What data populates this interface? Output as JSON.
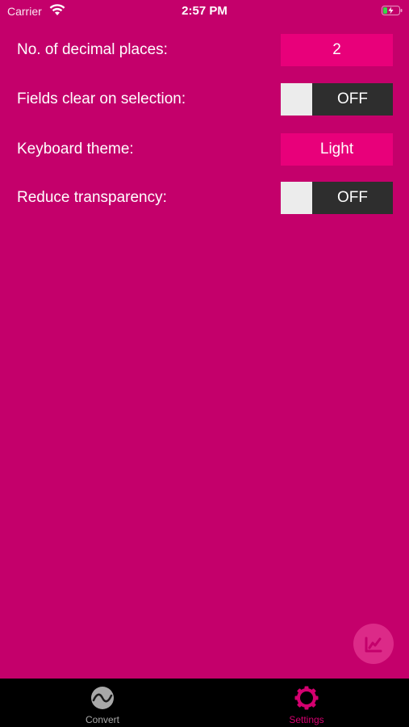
{
  "status_bar": {
    "carrier": "Carrier",
    "time": "2:57 PM",
    "wifi_icon": "wifi-icon",
    "battery_icon": "battery-charging-icon"
  },
  "settings": {
    "decimal_places": {
      "label": "No. of decimal places:",
      "value": "2"
    },
    "fields_clear": {
      "label": "Fields clear on selection:",
      "state": "OFF"
    },
    "keyboard_theme": {
      "label": "Keyboard theme:",
      "value": "Light"
    },
    "reduce_transparency": {
      "label": "Reduce transparency:",
      "state": "OFF"
    }
  },
  "fab": {
    "icon": "edit-chart-icon"
  },
  "tabs": [
    {
      "label": "Convert",
      "icon": "convert-wave-icon",
      "active": false
    },
    {
      "label": "Settings",
      "icon": "gear-icon",
      "active": true
    }
  ],
  "colors": {
    "background": "#c4006b",
    "value_button": "#e8007a",
    "toggle_track": "#2e2e2e",
    "toggle_knob": "#ececec",
    "tab_bar": "#000000",
    "active_tab": "#d4006f",
    "inactive_tab": "#a8a8a8"
  }
}
